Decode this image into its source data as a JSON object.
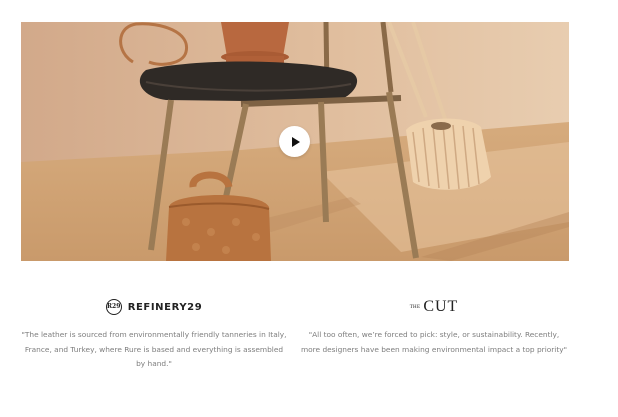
{
  "video": {
    "play_label": "Play video"
  },
  "press": [
    {
      "publication": "REFINERY29",
      "logo_mark": "R29",
      "quote": "\"The leather is sourced from environmentally friendly tanneries in Italy, France, and Turkey, where Rure is based and everything is assembled by hand.\""
    },
    {
      "publication_small": "THE",
      "publication": "CUT",
      "quote": "\"All too often, we’re forced to pick: style, or sustainability. Recently, more designers have been making environmental impact a top priority\""
    }
  ],
  "colors": {
    "quote_text": "#7d7d7d",
    "logo": "#222222",
    "backdrop": "#d9b287"
  },
  "icons": {
    "play": "play-icon",
    "refinery29": "refinery29-logo-icon"
  }
}
